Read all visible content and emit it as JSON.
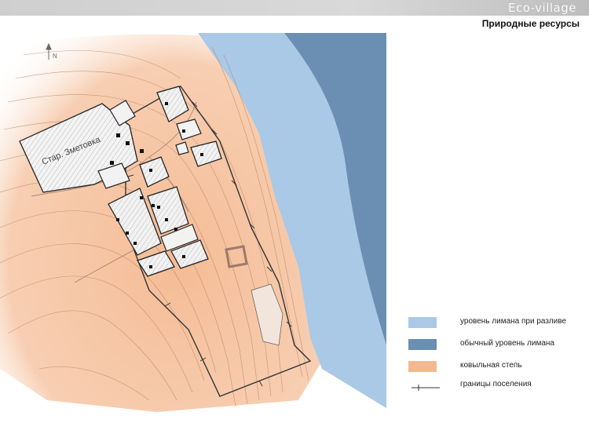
{
  "header": {
    "brand": "Eco-village",
    "subtitle": "Природные ресурсы"
  },
  "map": {
    "place_label": "Стар. Зметовка",
    "north_label": "N",
    "colors": {
      "flood_level": "#a9c9e6",
      "normal_level": "#6b8fb3",
      "steppe": "#f4b88f",
      "boundary": "#333333"
    }
  },
  "legend": {
    "items": [
      {
        "key": "flood",
        "label": "уровень лимана при разливе",
        "color": "#a9c9e6",
        "symbol": "swatch"
      },
      {
        "key": "normal",
        "label": "обычный уровень лимана",
        "color": "#6b8fb3",
        "symbol": "swatch"
      },
      {
        "key": "steppe",
        "label": "ковыльная степь",
        "color": "#f4b88f",
        "symbol": "swatch"
      },
      {
        "key": "boundary",
        "label": "границы поселения",
        "color": "#333333",
        "symbol": "line"
      }
    ]
  }
}
